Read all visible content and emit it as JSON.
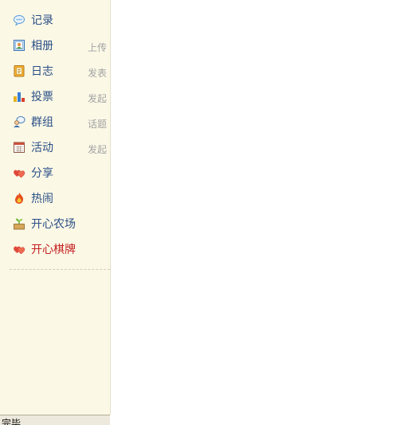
{
  "sidebar": {
    "items": [
      {
        "label": "记录",
        "hint": "",
        "icon": "speech-bubble-icon"
      },
      {
        "label": "相册",
        "hint": "上传",
        "icon": "photo-album-icon"
      },
      {
        "label": "日志",
        "hint": "发表",
        "icon": "notebook-icon"
      },
      {
        "label": "投票",
        "hint": "发起",
        "icon": "bar-chart-icon"
      },
      {
        "label": "群组",
        "hint": "话题",
        "icon": "group-chat-icon"
      },
      {
        "label": "活动",
        "hint": "发起",
        "icon": "calendar-icon"
      },
      {
        "label": "分享",
        "hint": "",
        "icon": "heart-share-icon"
      },
      {
        "label": "热闹",
        "hint": "",
        "icon": "flame-icon"
      },
      {
        "label": "开心农场",
        "hint": "",
        "icon": "farm-sprout-icon"
      },
      {
        "label": "开心棋牌",
        "hint": "",
        "icon": "heart-cards-icon"
      }
    ]
  },
  "statusbar": {
    "text": "完毕"
  }
}
